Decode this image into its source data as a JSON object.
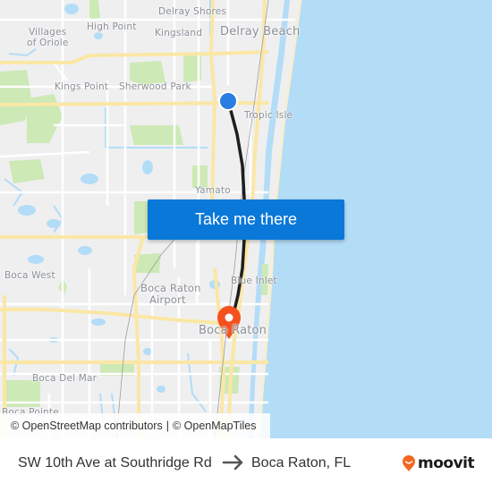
{
  "map": {
    "place_labels": [
      {
        "id": "delray-shores",
        "text": "Delray Shores"
      },
      {
        "id": "villages-of-oriole-1",
        "text": "Villages"
      },
      {
        "id": "villages-of-oriole-2",
        "text": "of Oriole"
      },
      {
        "id": "high-point",
        "text": "High Point"
      },
      {
        "id": "kingsland",
        "text": "Kingsland"
      },
      {
        "id": "delray-beach",
        "text": "Delray Beach"
      },
      {
        "id": "kings-point",
        "text": "Kings Point"
      },
      {
        "id": "sherwood-park",
        "text": "Sherwood Park"
      },
      {
        "id": "tropic-isle",
        "text": "Tropic Isle"
      },
      {
        "id": "yamato",
        "text": "Yamato"
      },
      {
        "id": "boca-west",
        "text": "Boca West"
      },
      {
        "id": "boca-raton-airport-1",
        "text": "Boca Raton"
      },
      {
        "id": "boca-raton-airport-2",
        "text": "Airport"
      },
      {
        "id": "blue-inlet",
        "text": "Blue Inlet"
      },
      {
        "id": "boca-raton",
        "text": "Boca Raton"
      },
      {
        "id": "boca-del-mar",
        "text": "Boca Del Mar"
      },
      {
        "id": "boca-pointe",
        "text": "Boca Pointe"
      }
    ],
    "origin_marker_color": "#2a7de1",
    "destination_marker_color": "#f4511e",
    "route_color": "#1e1e1e",
    "water_color": "#b3dcf7",
    "road_color": "#fbe7a5",
    "park_color": "#cde9b6"
  },
  "cta": {
    "label": "Take me there",
    "color": "#0a78d8"
  },
  "attribution": {
    "osm": "© OpenStreetMap contributors",
    "separator": "|",
    "omt": "© OpenMapTiles"
  },
  "footer": {
    "origin": "SW 10th Ave at Southridge Rd",
    "arrow_icon": "arrow-right-icon",
    "destination": "Boca Raton, FL",
    "brand": "moovit",
    "brand_color": "#f26722"
  }
}
